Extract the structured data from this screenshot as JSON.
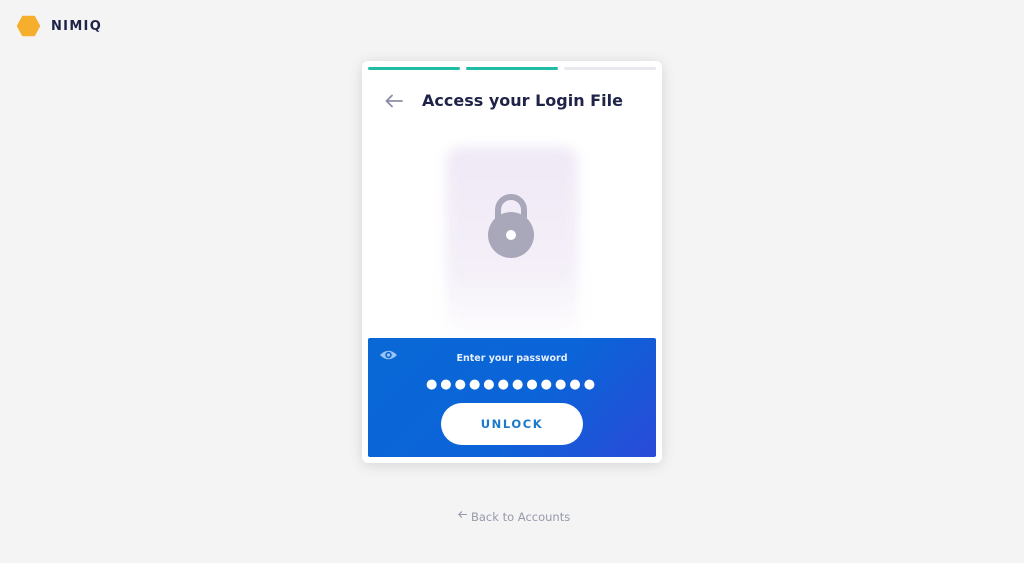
{
  "brand": {
    "name": "NIMIQ",
    "logo_icon": "hexagon-logo-icon",
    "logo_color": "#f6ae2d"
  },
  "card": {
    "progress": {
      "steps": 3,
      "completed": 2,
      "color": "#21bca5"
    },
    "back_icon": "arrow-left-icon",
    "title": "Access your Login File",
    "file_icon": "lock-icon"
  },
  "password_panel": {
    "eye_icon": "eye-icon",
    "label": "Enter your password",
    "masked_value": "●●●●●●●●●●●●",
    "unlock_label": "UNLOCK",
    "gradient_colors": [
      "#0a68d6",
      "#2a4ad8"
    ]
  },
  "footer": {
    "back_link_icon": "arrow-left-icon",
    "back_link_label": "Back to Accounts"
  }
}
